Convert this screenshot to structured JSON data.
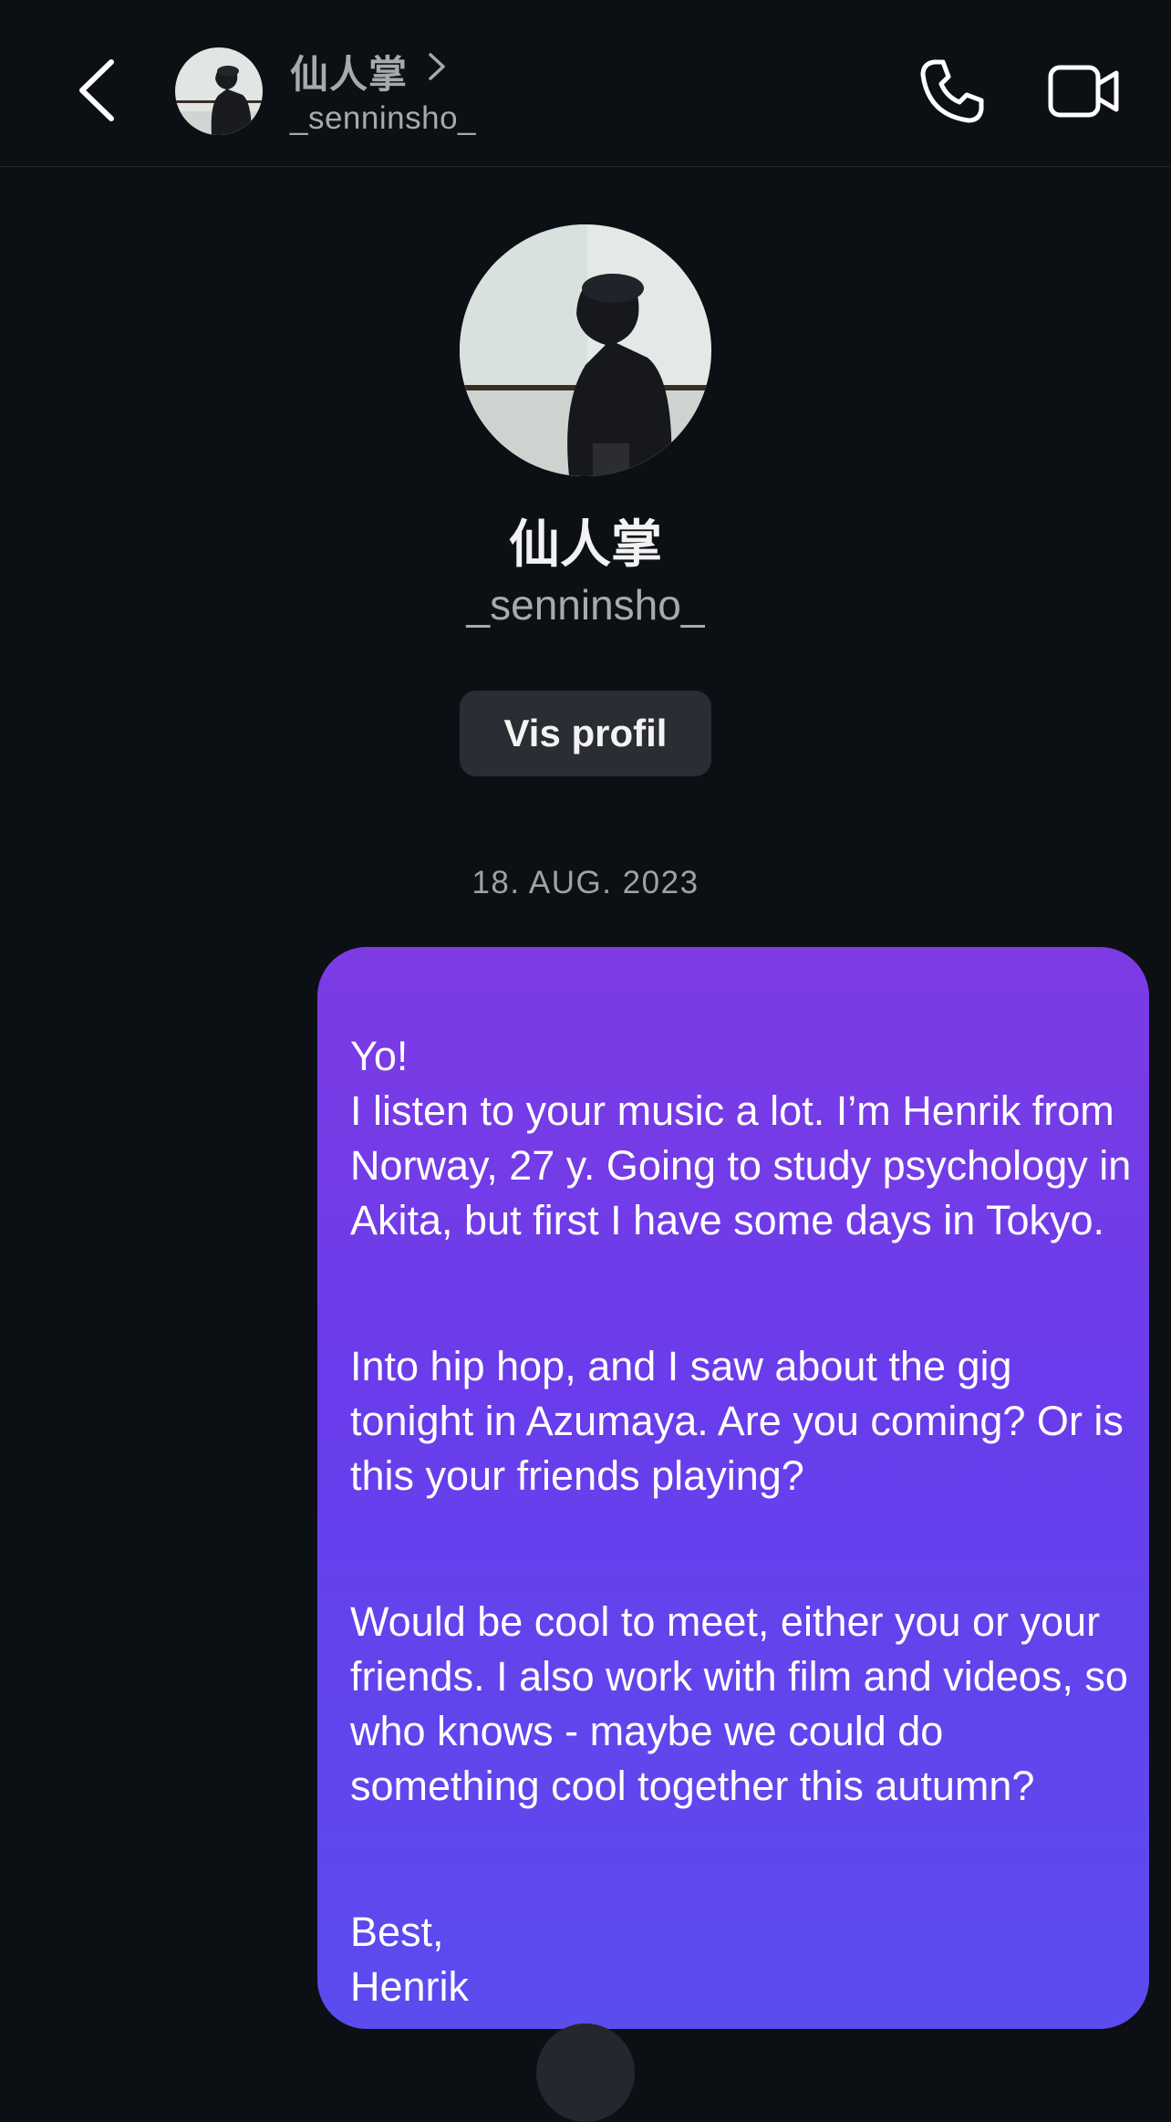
{
  "header": {
    "display_name": "仙人掌",
    "username": "_senninsho_",
    "icons": [
      "back-chevron-icon",
      "chevron-right-icon",
      "phone-icon",
      "video-camera-icon"
    ]
  },
  "profile": {
    "display_name": "仙人掌",
    "username": "_senninsho_",
    "view_profile_label": "Vis profil"
  },
  "thread": {
    "date_separator": "18. AUG. 2023",
    "message": {
      "paragraphs": [
        "Yo!\nI listen to your music a lot. I’m Henrik from Norway, 27 y. Going to study psychology in Akita, but first I have some days in Tokyo.",
        "Into hip hop, and I saw about the gig tonight in Azumaya. Are you coming? Or is this your friends playing?",
        "Would be cool to meet, either you or your friends. I also work with film and videos, so who knows - maybe we could do something cool together this autumn?",
        "Best,\nHenrik"
      ]
    }
  },
  "colors": {
    "background": "#0c0f14",
    "bubble_top": "#7d3be3",
    "bubble_bottom": "#5a4cee",
    "button_bg": "#2a2d33"
  }
}
